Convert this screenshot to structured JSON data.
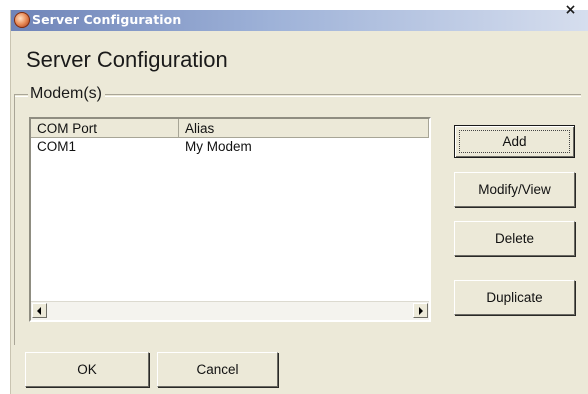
{
  "window": {
    "title": "Server Configuration",
    "close_glyph": "×",
    "app_icon": "server-config-globe-icon"
  },
  "heading": "Server Configuration",
  "group": {
    "label": "Modem(s)"
  },
  "list": {
    "columns": [
      "COM Port",
      "Alias"
    ],
    "rows": [
      [
        "COM1",
        "My Modem"
      ]
    ]
  },
  "buttons": {
    "add": "Add",
    "modify": "Modify/View",
    "delete": "Delete",
    "duplicate": "Duplicate",
    "ok": "OK",
    "cancel": "Cancel"
  },
  "colors": {
    "face": "#ece9d8",
    "titlebar_start": "#6f84b8",
    "titlebar_end": "#d6deee",
    "list_bg": "#ffffff"
  }
}
